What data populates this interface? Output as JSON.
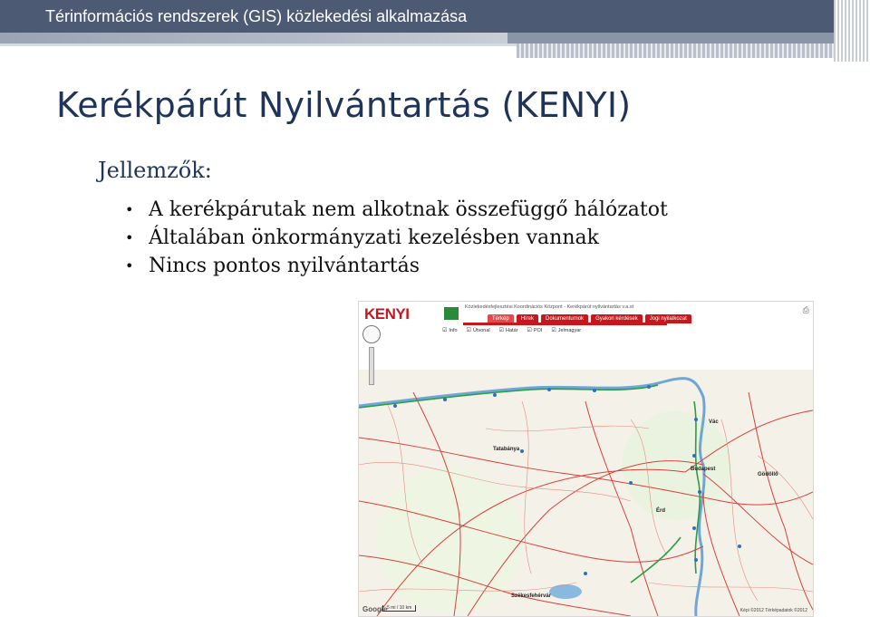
{
  "header": {
    "title": "Térinformációs rendszerek (GIS) közlekedési alkalmazása"
  },
  "slide": {
    "title": "Kerékpárút Nyilvántartás (KENYI)",
    "section": "Jellemzők:",
    "bullets": [
      "A kerékpárutak nem alkotnak összefüggő hálózatot",
      "Általában önkormányzati kezelésben vannak",
      "Nincs pontos nyilvántartás"
    ]
  },
  "screenshot": {
    "logo": "KENYI",
    "site_subtitle": "Közlekedésfejlesztési Koordinációs Központ - Kerékpárút nyilvántartás v.a.st",
    "tabs": [
      "Térkép",
      "Hírek",
      "Dokumentumok",
      "Gyakori kérdések",
      "Jogi nyilatkozat"
    ],
    "checkboxes": [
      "Info",
      "Útvonal",
      "Határ",
      "POI",
      "Jelmagyar"
    ],
    "map": {
      "cities": [
        "Tatabánya",
        "Budapest",
        "Székesfehérvár",
        "Vác",
        "Gödöllő",
        "Érd"
      ],
      "google": "Google",
      "scale": "5 mi / 10 km",
      "copyright": "Képi ©2012 Térképadatok ©2012"
    }
  },
  "colors": {
    "header_bg": "#4d5a73",
    "title_color": "#1f3458",
    "kenyi_red": "#c8161d"
  }
}
